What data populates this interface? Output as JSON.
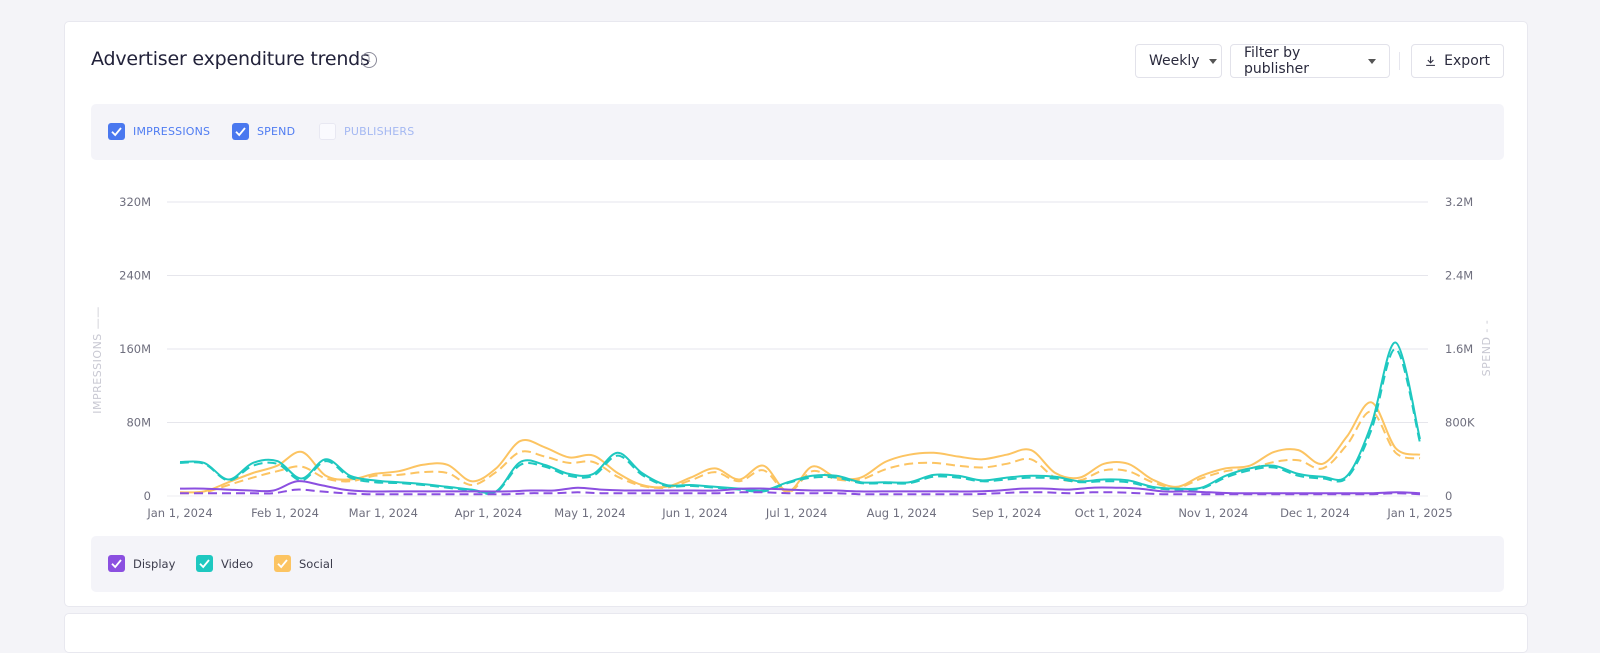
{
  "header": {
    "title": "Advertiser expenditure trends",
    "info_icon": "info-circle-icon",
    "interval_select": "Weekly",
    "publisher_filter": "Filter by publisher",
    "export_label": "Export",
    "export_icon": "download-icon"
  },
  "metrics": [
    {
      "label": "IMPRESSIONS",
      "checked": true
    },
    {
      "label": "SPEND",
      "checked": true
    },
    {
      "label": "PUBLISHERS",
      "checked": false
    }
  ],
  "series_legend": [
    {
      "label": "Display",
      "color": "#8b4fe0",
      "checked": true
    },
    {
      "label": "Video",
      "color": "#1ec8c0",
      "checked": true
    },
    {
      "label": "Social",
      "color": "#fcc462",
      "checked": true
    }
  ],
  "colors": {
    "accent": "#4a78ef",
    "display": "#8b4fe0",
    "video": "#1ec8c0",
    "social": "#fcc462",
    "grid": "#e6e6ec"
  },
  "chart_data": {
    "type": "line",
    "title": "Advertiser expenditure trends",
    "x_start": "2024-01-01",
    "x_end": "2025-01-01",
    "x_step": "week",
    "xticks": [
      "Jan 1, 2024",
      "Feb 1, 2024",
      "Mar 1, 2024",
      "Apr 1, 2024",
      "May 1, 2024",
      "Jun 1, 2024",
      "Jul 1, 2024",
      "Aug 1, 2024",
      "Sep 1, 2024",
      "Oct 1, 2024",
      "Nov 1, 2024",
      "Dec 1, 2024",
      "Jan 1, 2025"
    ],
    "xtick_days": [
      0,
      31,
      60,
      91,
      121,
      152,
      182,
      213,
      244,
      274,
      305,
      335,
      366
    ],
    "y_left": {
      "label": "IMPRESSIONS",
      "line_style": "solid",
      "range": [
        0,
        320000000
      ],
      "ticks": [
        "0",
        "80M",
        "160M",
        "240M",
        "320M"
      ],
      "tick_values": [
        0,
        80000000,
        160000000,
        240000000,
        320000000
      ]
    },
    "y_right": {
      "label": "SPEND",
      "line_style": "dashed",
      "range": [
        0,
        3200000
      ],
      "ticks": [
        "0",
        "800K",
        "1.6M",
        "2.4M",
        "3.2M"
      ],
      "tick_values": [
        0,
        800000,
        1600000,
        2400000,
        3200000
      ]
    },
    "grid": true,
    "series": [
      {
        "name": "Display",
        "metric": "Impressions",
        "axis": "left",
        "unit": "M",
        "values": [
          8,
          8,
          7,
          6,
          6,
          16,
          12,
          7,
          5,
          5,
          5,
          5,
          5,
          5,
          5,
          6,
          6,
          9,
          7,
          6,
          6,
          6,
          6,
          6,
          8,
          8,
          7,
          6,
          6,
          5,
          5,
          5,
          5,
          5,
          5,
          6,
          8,
          8,
          7,
          9,
          9,
          8,
          5,
          5,
          4,
          3,
          3,
          3,
          3,
          3,
          3,
          3,
          4,
          3
        ]
      },
      {
        "name": "Display",
        "metric": "Spend",
        "axis": "right",
        "unit": "K",
        "values": [
          30,
          30,
          30,
          30,
          30,
          70,
          50,
          30,
          20,
          20,
          20,
          20,
          20,
          20,
          20,
          30,
          30,
          40,
          30,
          30,
          30,
          30,
          30,
          30,
          40,
          40,
          30,
          30,
          30,
          20,
          20,
          20,
          20,
          20,
          20,
          30,
          40,
          40,
          30,
          40,
          40,
          30,
          20,
          20,
          20,
          20,
          20,
          20,
          20,
          20,
          20,
          20,
          30,
          20
        ]
      },
      {
        "name": "Video",
        "metric": "Impressions",
        "axis": "left",
        "unit": "M",
        "values": [
          37,
          36,
          18,
          36,
          38,
          19,
          40,
          22,
          17,
          15,
          13,
          10,
          7,
          5,
          37,
          34,
          24,
          24,
          47,
          25,
          12,
          12,
          10,
          8,
          6,
          15,
          22,
          22,
          15,
          15,
          15,
          23,
          22,
          17,
          20,
          22,
          21,
          16,
          18,
          17,
          10,
          8,
          9,
          22,
          30,
          33,
          24,
          21,
          22,
          78,
          167,
          62
        ]
      },
      {
        "name": "Video",
        "metric": "Spend",
        "axis": "right",
        "unit": "K",
        "values": [
          360,
          350,
          170,
          330,
          350,
          170,
          380,
          200,
          150,
          140,
          120,
          90,
          60,
          40,
          340,
          320,
          220,
          220,
          440,
          230,
          110,
          110,
          90,
          70,
          50,
          140,
          200,
          200,
          140,
          140,
          140,
          210,
          200,
          160,
          180,
          200,
          190,
          150,
          160,
          150,
          90,
          70,
          80,
          200,
          280,
          310,
          220,
          190,
          200,
          720,
          1600,
          580
        ]
      },
      {
        "name": "Social",
        "metric": "Impressions",
        "axis": "left",
        "unit": "M",
        "values": [
          4,
          5,
          15,
          25,
          33,
          48,
          22,
          18,
          24,
          27,
          34,
          34,
          16,
          30,
          60,
          53,
          42,
          44,
          25,
          12,
          10,
          20,
          30,
          18,
          33,
          5,
          32,
          20,
          20,
          37,
          45,
          47,
          43,
          40,
          45,
          50,
          25,
          20,
          35,
          35,
          18,
          10,
          22,
          30,
          33,
          48,
          50,
          35,
          65,
          102,
          52,
          45
        ]
      },
      {
        "name": "Social",
        "metric": "Spend",
        "axis": "right",
        "unit": "K",
        "values": [
          30,
          40,
          120,
          200,
          270,
          320,
          190,
          160,
          220,
          230,
          260,
          250,
          120,
          260,
          480,
          430,
          360,
          370,
          210,
          110,
          90,
          170,
          260,
          160,
          280,
          40,
          270,
          180,
          180,
          290,
          350,
          360,
          330,
          310,
          350,
          400,
          200,
          170,
          280,
          270,
          150,
          90,
          190,
          270,
          300,
          370,
          390,
          300,
          560,
          920,
          470,
          410
        ]
      }
    ]
  }
}
